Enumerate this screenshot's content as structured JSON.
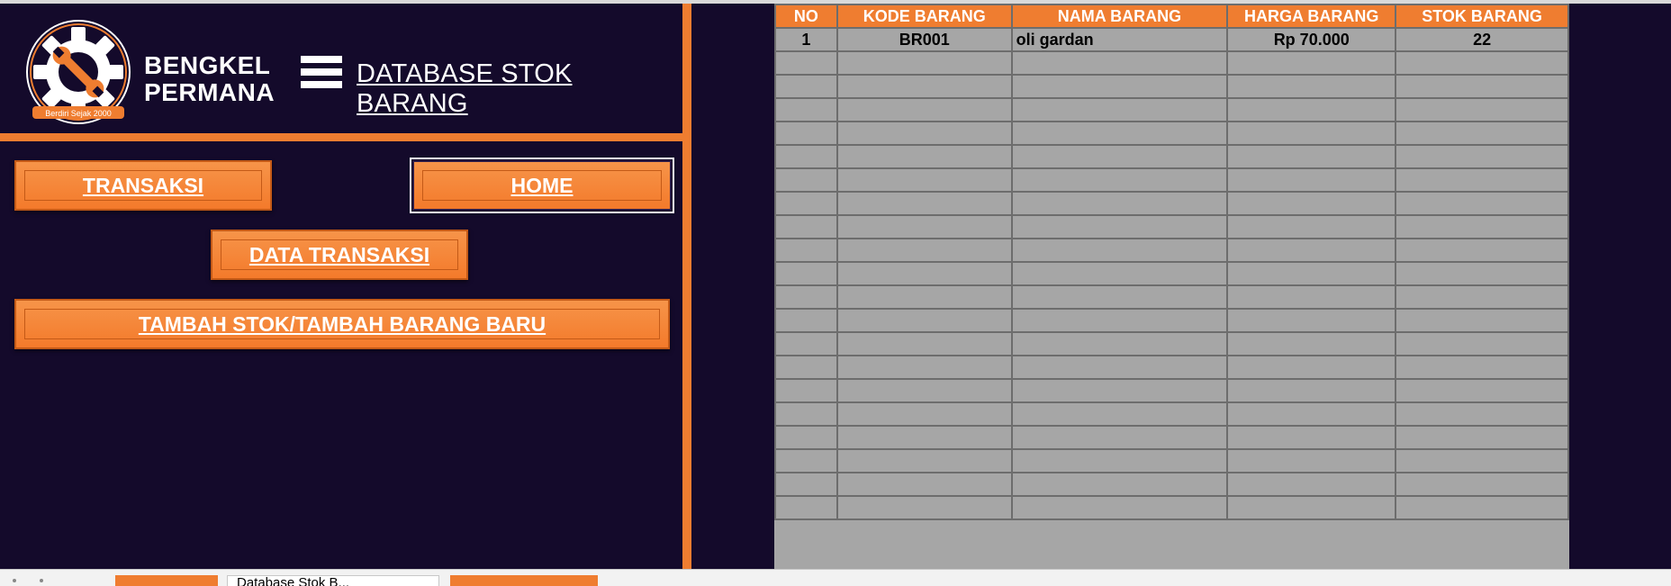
{
  "header": {
    "brand_line1": "BENGKEL",
    "brand_line2": "PERMANA",
    "logo_caption": "Berdiri Sejak 2000",
    "page_title": "DATABASE STOK BARANG"
  },
  "nav": {
    "transaksi": "TRANSAKSI",
    "home": "HOME",
    "data_transaksi": "DATA TRANSAKSI",
    "tambah_stok": "TAMBAH STOK/TAMBAH BARANG BARU"
  },
  "table": {
    "columns": [
      "NO",
      "KODE BARANG",
      "NAMA BARANG",
      "HARGA BARANG",
      "STOK BARANG"
    ],
    "rows": [
      [
        "1",
        "BR001",
        "oli gardan",
        "Rp 70.000",
        "22"
      ]
    ]
  },
  "sheet_tabs": {
    "active": "Database Stok B..."
  },
  "colors": {
    "background": "#140a2b",
    "accent": "#ef7d30",
    "cell": "#a6a6a6"
  }
}
